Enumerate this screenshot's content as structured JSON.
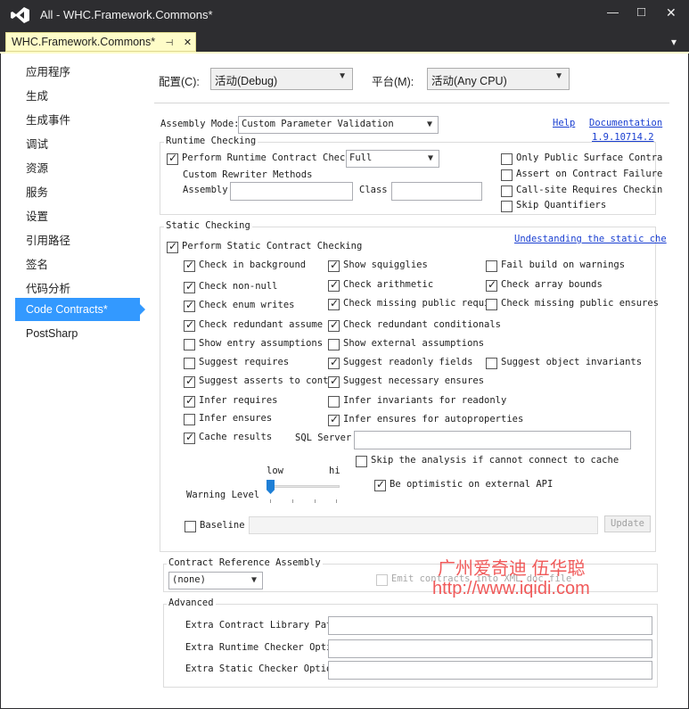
{
  "window": {
    "title": "All - WHC.Framework.Commons*",
    "doc_tab": "WHC.Framework.Commons*",
    "pin_glyph": "⊣",
    "tab_close_glyph": "✕",
    "min_glyph": "—",
    "max_glyph": "□",
    "close_glyph": "✕",
    "dropdown_glyph": "▾"
  },
  "sidebar": {
    "items": [
      "应用程序",
      "生成",
      "生成事件",
      "调试",
      "资源",
      "服务",
      "设置",
      "引用路径",
      "签名",
      "代码分析",
      "Code Contracts*",
      "PostSharp"
    ],
    "selected_index": 10
  },
  "config": {
    "config_label": "配置(C):",
    "config_value": "活动(Debug)",
    "platform_label": "平台(M):",
    "platform_value": "活动(Any CPU)"
  },
  "assembly_mode": {
    "label": "Assembly Mode:",
    "value": "Custom Parameter Validation",
    "help_link": "Help",
    "doc_link": "Documentation",
    "version_link": "1.9.10714.2"
  },
  "runtime": {
    "group_title": "Runtime Checking",
    "perform_label": "Perform Runtime Contract Checki",
    "perform_checked": true,
    "level_value": "Full",
    "rewriter_label": "Custom Rewriter Methods",
    "assembly_label": "Assembly",
    "assembly_value": "",
    "class_label": "Class",
    "class_value": "",
    "right_options": [
      {
        "label": "Only Public Surface Contra",
        "checked": false
      },
      {
        "label": "Assert on Contract Failure",
        "checked": false
      },
      {
        "label": "Call-site Requires Checkin",
        "checked": false
      },
      {
        "label": "Skip Quantifiers",
        "checked": false
      }
    ]
  },
  "static": {
    "group_title": "Static Checking",
    "perform_label": "Perform Static Contract Checking",
    "perform_checked": true,
    "understanding_link": "Undestanding the static che",
    "col1": [
      {
        "label": "Check in background",
        "checked": true
      },
      {
        "label": "Check non-null",
        "checked": true
      },
      {
        "label": "Check enum writes",
        "checked": true
      },
      {
        "label": "Check redundant assume",
        "checked": true
      },
      {
        "label": "Show entry assumptions",
        "checked": false
      },
      {
        "label": "Suggest requires",
        "checked": false
      },
      {
        "label": "Suggest asserts to contr",
        "checked": true
      },
      {
        "label": "Infer requires",
        "checked": true
      },
      {
        "label": "Infer ensures",
        "checked": false
      },
      {
        "label": "Cache results",
        "checked": true
      }
    ],
    "col2": [
      {
        "label": "Show squigglies",
        "checked": true
      },
      {
        "label": "Check arithmetic",
        "checked": true
      },
      {
        "label": "Check missing public requir",
        "checked": true
      },
      {
        "label": "Check redundant conditionals",
        "checked": true
      },
      {
        "label": "Show external assumptions",
        "checked": false
      },
      {
        "label": "Suggest readonly fields",
        "checked": true
      },
      {
        "label": "Suggest necessary ensures",
        "checked": true
      },
      {
        "label": "Infer invariants for readonly",
        "checked": false
      },
      {
        "label": "Infer ensures for autoproperties",
        "checked": true
      }
    ],
    "col3": [
      {
        "label": "Fail build on warnings",
        "checked": false
      },
      {
        "label": "Check array bounds",
        "checked": true
      },
      {
        "label": "Check missing public ensures",
        "checked": false
      },
      {
        "label": "Suggest object invariants",
        "checked": false
      }
    ],
    "sql_label": "SQL Server",
    "sql_value": "",
    "skip_label": "Skip the analysis if cannot connect to cache",
    "skip_checked": false,
    "optimistic_label": "Be optimistic on external API",
    "optimistic_checked": true,
    "warning_label": "Warning Level",
    "slider_low": "low",
    "slider_high": "hi",
    "slider_level": 0,
    "baseline_label": "Baseline",
    "baseline_checked": false,
    "baseline_value": "",
    "update_button": "Update"
  },
  "reference": {
    "group_title": "Contract Reference Assembly",
    "value": "(none)",
    "emit_label": "Emit contracts into XML doc file",
    "emit_checked": false
  },
  "advanced": {
    "group_title": "Advanced",
    "library_label": "Extra Contract Library Paths",
    "runtime_label": "Extra Runtime Checker Optio",
    "static_label": "Extra Static Checker Option",
    "library_value": "",
    "runtime_value": "",
    "static_value": ""
  },
  "watermark": {
    "line1": "广州爱奇迪  伍华聪",
    "line2": "http://www.iqidi.com"
  },
  "colors": {
    "selected_bg": "#3399ff",
    "tab_bg": "#fefcc8",
    "link": "#1a3fd1",
    "watermark": "#f05a5a",
    "frame": "#2d2d30"
  }
}
